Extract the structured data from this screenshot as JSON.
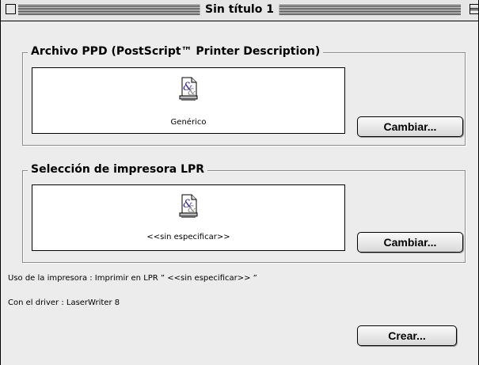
{
  "window": {
    "title": "Sin título 1"
  },
  "ppd_section": {
    "label": "Archivo PPD (PostScript™ Printer Description)",
    "file_name": "Genérico",
    "change_button": "Cambiar..."
  },
  "lpr_section": {
    "label": "Selección de impresora LPR",
    "printer_name": "<<sin especificar>>",
    "change_button": "Cambiar..."
  },
  "info": {
    "usage": "Uso de la impresora : Imprimir en LPR ” <<sin especificar>> ”",
    "driver": "Con el driver : LaserWriter 8"
  },
  "create_button": "Crear...",
  "icons": {
    "document": "ampersand-document-icon"
  }
}
